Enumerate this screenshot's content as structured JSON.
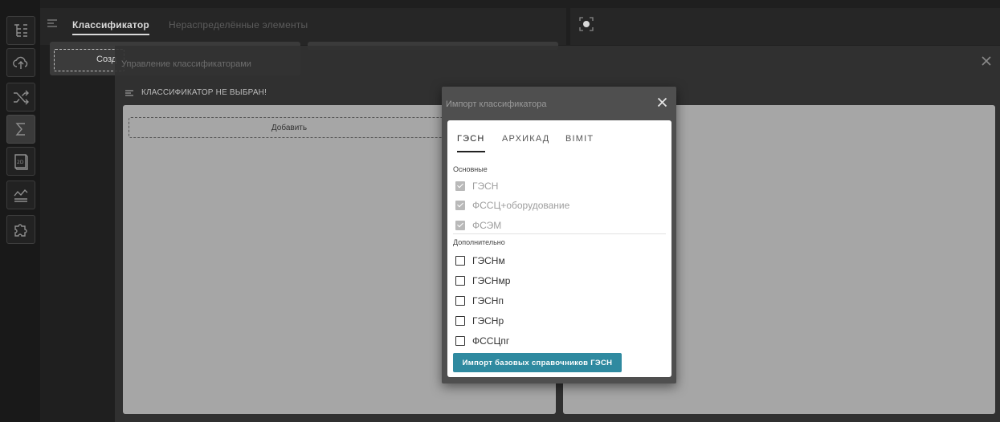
{
  "rail": {
    "items": [
      {
        "icon": "tree-structure-icon"
      },
      {
        "icon": "cloud-upload-icon"
      },
      {
        "icon": "shuffle-icon"
      },
      {
        "icon": "sigma-icon"
      },
      {
        "icon": "2d-icon"
      },
      {
        "icon": "chart-lines-icon"
      },
      {
        "icon": "puzzle-icon"
      }
    ]
  },
  "topbar": {
    "tab_active": "Классификатор",
    "tab_inactive": "Нераспределённые элементы"
  },
  "workspace": {
    "create_button_partial": "Созд"
  },
  "overlay": {
    "title": "Управление классификаторами",
    "subheader": "КЛАССИФИКАТОР НЕ ВЫБРАН!",
    "add_button": "Добавить"
  },
  "modal": {
    "title": "Импорт классификатора",
    "tabs": [
      "ГЭСН",
      "АРХИКАД",
      "BIMIT"
    ],
    "section_main": "Основные",
    "main_items": [
      {
        "label": "ГЭСН",
        "checked": true,
        "disabled": true
      },
      {
        "label": "ФССЦ+оборудование",
        "checked": true,
        "disabled": true
      },
      {
        "label": "ФСЭМ",
        "checked": true,
        "disabled": true
      }
    ],
    "section_extra": "Дополнительно",
    "extra_items": [
      {
        "label": "ГЭСНм",
        "checked": false
      },
      {
        "label": "ГЭСНмр",
        "checked": false
      },
      {
        "label": "ГЭСНп",
        "checked": false
      },
      {
        "label": "ГЭСНр",
        "checked": false
      },
      {
        "label": "ФССЦпг",
        "checked": false
      }
    ],
    "import_button": "Импорт базовых справочников ГЭСН"
  },
  "colors": {
    "accent": "#2f8aa0",
    "modal_header": "#4f4f4f",
    "panel": "#a6a6a6"
  }
}
